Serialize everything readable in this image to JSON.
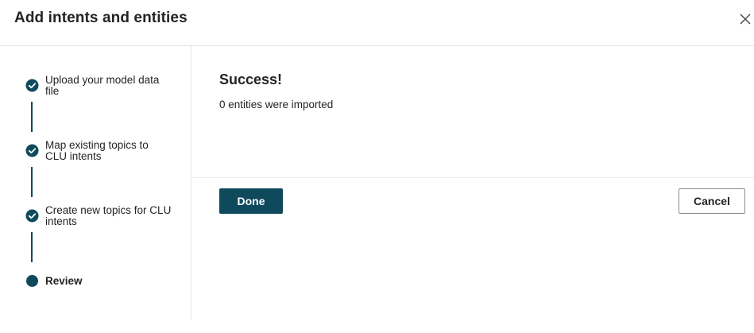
{
  "dialog": {
    "title": "Add intents and entities",
    "close_icon": "close-icon"
  },
  "steps": [
    {
      "label": "Upload your model data file",
      "status": "complete",
      "icon": "checkmark-circle-icon"
    },
    {
      "label": "Map existing topics to CLU intents",
      "status": "complete",
      "icon": "checkmark-circle-icon"
    },
    {
      "label": "Create new topics for CLU intents",
      "status": "complete",
      "icon": "checkmark-circle-icon"
    },
    {
      "label": "Review",
      "status": "current",
      "icon": "filled-circle-icon"
    }
  ],
  "content": {
    "heading": "Success!",
    "message": "0 entities were imported"
  },
  "footer": {
    "done_label": "Done",
    "cancel_label": "Cancel"
  },
  "colors": {
    "accent": "#0f4a5c",
    "text": "#242424",
    "divider": "#e6e6e6"
  }
}
